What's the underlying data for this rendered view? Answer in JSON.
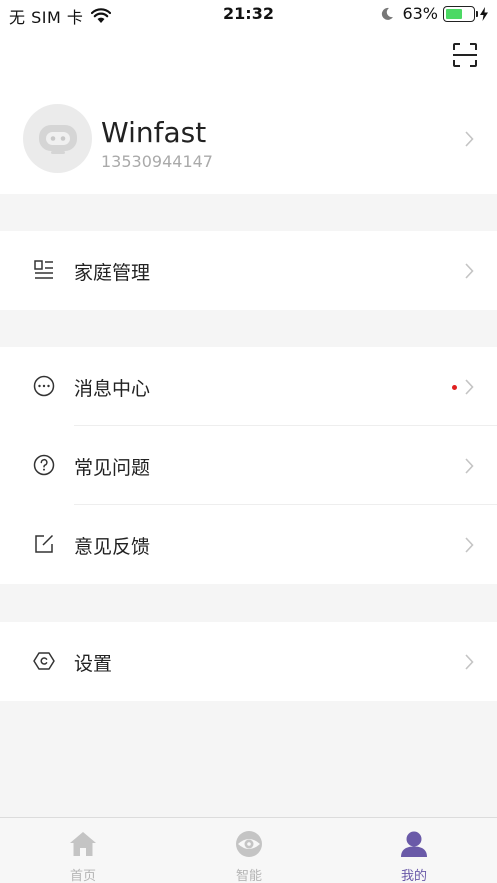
{
  "status_bar": {
    "carrier": "无 SIM 卡",
    "time": "21:32",
    "battery": "63%",
    "battery_level": 0.63
  },
  "profile": {
    "name": "Winfast",
    "phone": "13530944147"
  },
  "menu": {
    "family": {
      "label": "家庭管理",
      "icon": "family-list-icon"
    },
    "messages": {
      "label": "消息中心",
      "icon": "chat-bubble-icon",
      "has_unread": true
    },
    "faq": {
      "label": "常见问题",
      "icon": "question-icon"
    },
    "feedback": {
      "label": "意见反馈",
      "icon": "edit-icon"
    },
    "settings": {
      "label": "设置",
      "icon": "hexagon-settings-icon"
    }
  },
  "tabs": [
    {
      "label": "首页",
      "icon": "home-icon",
      "active": false
    },
    {
      "label": "智能",
      "icon": "smart-eye-icon",
      "active": false
    },
    {
      "label": "我的",
      "icon": "user-icon",
      "active": true
    }
  ],
  "colors": {
    "accent": "#6a5aa8",
    "inactive": "#b5b5b5",
    "unread_dot": "#e02020",
    "battery": "#4cd964"
  }
}
